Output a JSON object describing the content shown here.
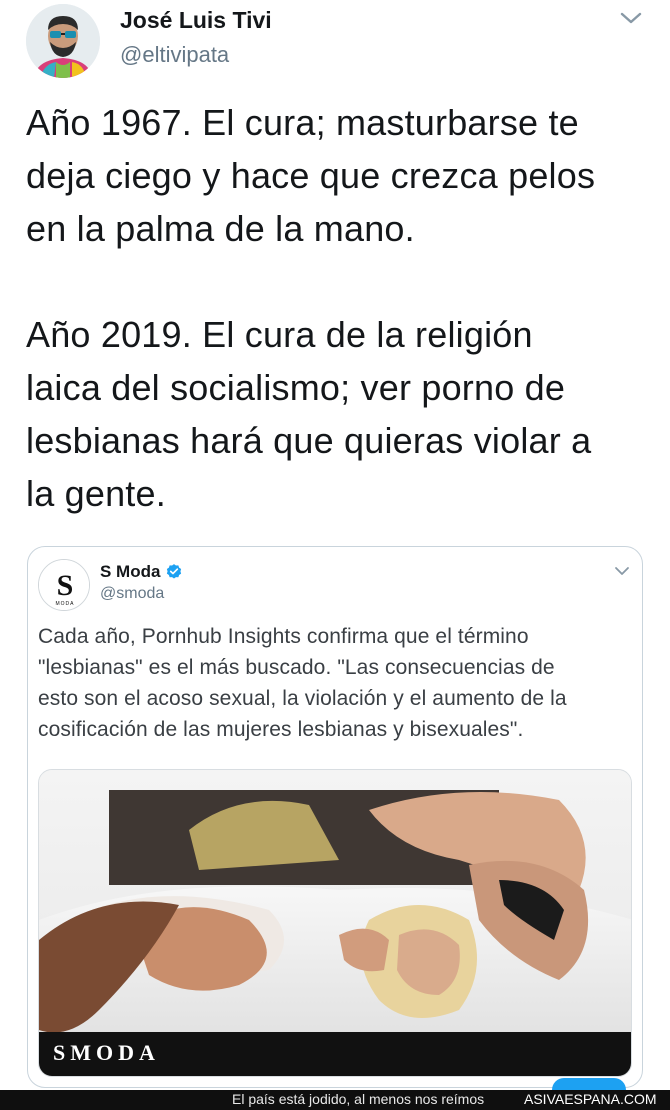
{
  "author": {
    "name": "José Luis Tivi",
    "handle": "@eltivipata"
  },
  "tweet": {
    "paragraph1": [
      "Año 1967. El cura; masturbarse te",
      "deja ciego y hace que crezca pelos",
      "en la palma de la mano."
    ],
    "paragraph2": [
      "Año 2019. El cura de la religión",
      "laica del socialismo; ver porno de",
      "lesbianas hará que quieras violar a",
      "la gente."
    ]
  },
  "quoted": {
    "name": "S Moda",
    "handle": "@smoda",
    "avatar_letter": "S",
    "avatar_sub": "MODA",
    "text": [
      "Cada año, Pornhub Insights confirma que el término",
      "\"lesbianas\" es el más buscado. \"Las consecuencias de",
      "esto son el acoso sexual, la violación y el aumento de la",
      "cosificación de las mujeres lesbianas y bisexuales\"."
    ],
    "media_brand": "SMODA"
  },
  "footer": {
    "caption": "El país está jodido, al menos nos reímos",
    "site": "ASIVAESPANA.COM"
  },
  "icons": {
    "more": "chevron-down-icon",
    "verified": "verified-badge-icon"
  },
  "colors": {
    "text": "#14171a",
    "secondary": "#657786",
    "accent": "#1da1f2",
    "border": "#c9d4dc"
  }
}
